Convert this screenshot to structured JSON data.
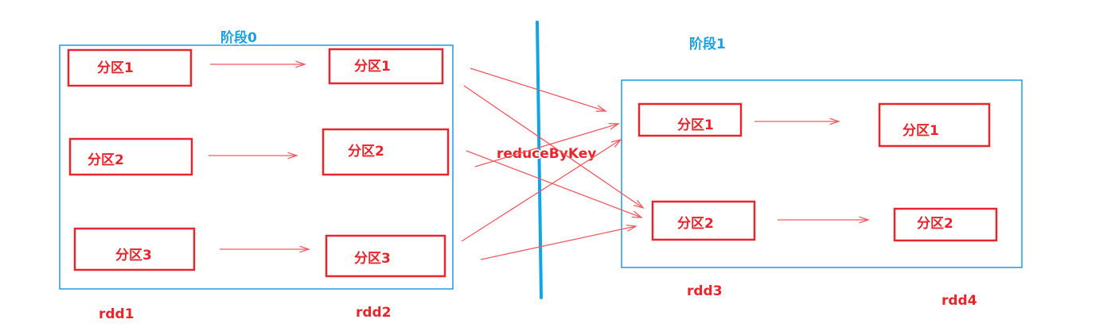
{
  "stages": [
    {
      "label": "阶段0"
    },
    {
      "label": "阶段1"
    }
  ],
  "rdds": [
    {
      "label": "rdd1",
      "partitions": [
        "分区1",
        "分区2",
        "分区3"
      ]
    },
    {
      "label": "rdd2",
      "partitions": [
        "分区1",
        "分区2",
        "分区3"
      ]
    },
    {
      "label": "rdd3",
      "partitions": [
        "分区1",
        "分区2"
      ]
    },
    {
      "label": "rdd4",
      "partitions": [
        "分区1",
        "分区2"
      ]
    }
  ],
  "shuffle_label": "reduceByKey",
  "colors": {
    "partition": "#e8242c",
    "stage": "#1e9ae0",
    "arrow": "#f05a60",
    "boundary": "#12a4e4"
  }
}
